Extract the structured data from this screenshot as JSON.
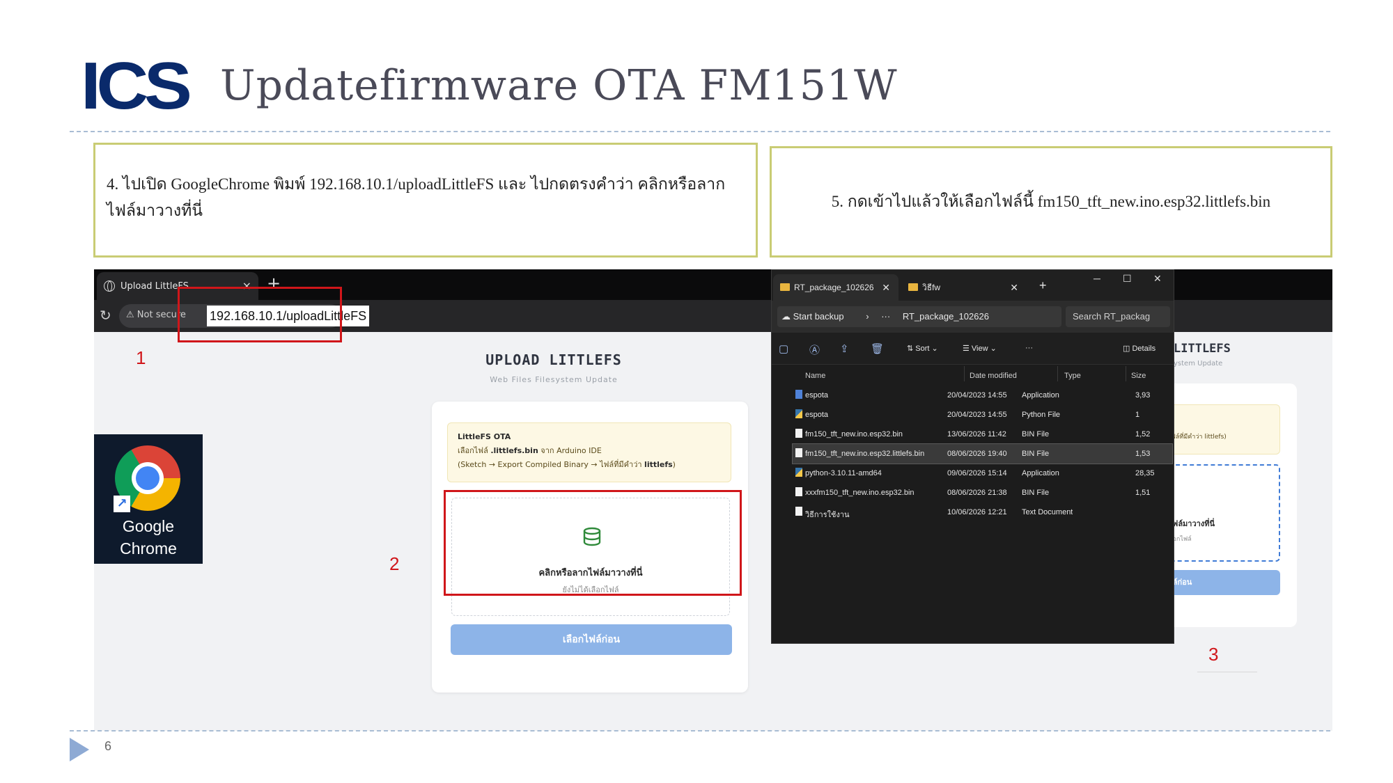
{
  "slide": {
    "logo": "ICS",
    "title": "Updatefirmware OTA FM151W",
    "page_number": "6",
    "step4_text": "4. ไปเปิด GoogleChrome พิมพ์ 192.168.10.1/uploadLittleFS และ ไปกดตรงคำว่า คลิกหรือลากไฟล์มาวางที่นี่",
    "step5_text": "5. กดเข้าไปแล้วให้เลือกไฟล์นี้ fm150_tft_new.ino.esp32.littlefs.bin",
    "markers": [
      "1",
      "2",
      "3"
    ]
  },
  "browser": {
    "tab_title": "Upload LittleFS",
    "not_secure": "Not secure",
    "url": "192.168.10.1/uploadLittleFS",
    "desktop_icon_label": "Google Chrome",
    "page_title": "UPLOAD LITTLEFS",
    "page_subtitle": "Web Files Filesystem Update",
    "info_title": "LittleFS OTA",
    "info_line1_prefix": "เลือกไฟล์",
    "info_line1_bold": ".littlefs.bin",
    "info_line1_suffix": "จาก Arduino IDE",
    "info_line2_prefix": "(Sketch → Export Compiled Binary → ไฟล์ที่มีคำว่า",
    "info_line2_bold": "littlefs",
    "info_line2_suffix": ")",
    "dropzone_main": "คลิกหรือลากไฟล์มาวางที่นี่",
    "dropzone_sub": "ยังไม่ได้เลือกไฟล์",
    "choose_button": "เลือกไฟล์ก่อน"
  },
  "background_page": {
    "title": "LITTLEFS",
    "subtitle": "ystem Update",
    "info_fragment": "ไฟล์ที่มีคำว่า littlefs)",
    "dropzone_main": "ไฟล์มาวางที่นี่",
    "dropzone_sub": "ลือกไฟล์",
    "button": "ฟล์ก่อน"
  },
  "explorer": {
    "tab1": "RT_package_102626",
    "tab2": "วิธีfw",
    "path_root": "Start backup",
    "path_more": "···",
    "path_current": "RT_package_102626",
    "search_placeholder": "Search RT_packag",
    "toolbar": {
      "sort": "Sort",
      "view": "View",
      "more": "···",
      "details": "Details"
    },
    "columns": [
      "Name",
      "Date modified",
      "Type",
      "Size"
    ],
    "files": [
      {
        "name": "espota",
        "date": "20/04/2023 14:55",
        "type": "Application",
        "size": "3,93",
        "icon": "app",
        "selected": false
      },
      {
        "name": "espota",
        "date": "20/04/2023 14:55",
        "type": "Python File",
        "size": "1",
        "icon": "python",
        "selected": false
      },
      {
        "name": "fm150_tft_new.ino.esp32.bin",
        "date": "13/06/2026 11:42",
        "type": "BIN File",
        "size": "1,52",
        "icon": "file",
        "selected": false
      },
      {
        "name": "fm150_tft_new.ino.esp32.littlefs.bin",
        "date": "08/06/2026 19:40",
        "type": "BIN File",
        "size": "1,53",
        "icon": "file",
        "selected": true
      },
      {
        "name": "python-3.10.11-amd64",
        "date": "09/06/2026 15:14",
        "type": "Application",
        "size": "28,35",
        "icon": "python",
        "selected": false
      },
      {
        "name": "xxxfm150_tft_new.ino.esp32.bin",
        "date": "08/06/2026 21:38",
        "type": "BIN File",
        "size": "1,51",
        "icon": "file",
        "selected": false
      },
      {
        "name": "วิธีการใช้งาน",
        "date": "10/06/2026 12:21",
        "type": "Text Document",
        "size": "",
        "icon": "file",
        "selected": false
      }
    ]
  },
  "colors": {
    "logo": "#0a2a6b",
    "highlight_red": "#d0161a",
    "step_border": "#c9cc74",
    "button_blue": "#8db4e8"
  }
}
